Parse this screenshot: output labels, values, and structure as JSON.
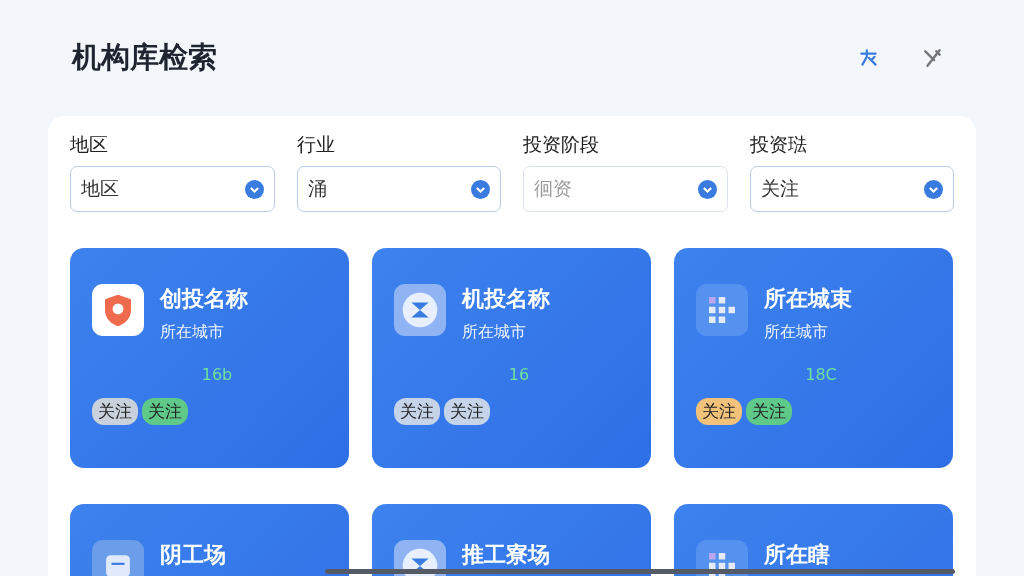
{
  "title": "机构库检索",
  "filters": [
    {
      "label": "地区",
      "value": "地区"
    },
    {
      "label": "行业",
      "value": "涌"
    },
    {
      "label": "投资阶段",
      "placeholder": "徊资"
    },
    {
      "label": "投资琺",
      "value": "关注"
    }
  ],
  "cards": [
    {
      "kind": "shield",
      "name": "创投名称",
      "city": "所在城市",
      "count": "16b",
      "tags": [
        {
          "label": "关注",
          "color": "#c9d1dc"
        },
        {
          "label": "关注",
          "color": "#5fc98a"
        }
      ]
    },
    {
      "kind": "badge",
      "name": "机投名称",
      "city": "所在城市",
      "count": "16",
      "tags": [
        {
          "label": "关注",
          "color": "#c6d4ea"
        },
        {
          "label": "关注",
          "color": "#c6d4ea"
        }
      ]
    },
    {
      "kind": "grid",
      "name": "所在城束",
      "city": "所在城市",
      "count": "18C",
      "tags": [
        {
          "label": "关注",
          "color": "#f2c27b"
        },
        {
          "label": "关注",
          "color": "#5fc98a"
        }
      ]
    },
    {
      "kind": "tray",
      "name": "阴工场"
    },
    {
      "kind": "badge",
      "name": "推工寮场"
    },
    {
      "kind": "grid",
      "name": "所在瞎"
    }
  ]
}
